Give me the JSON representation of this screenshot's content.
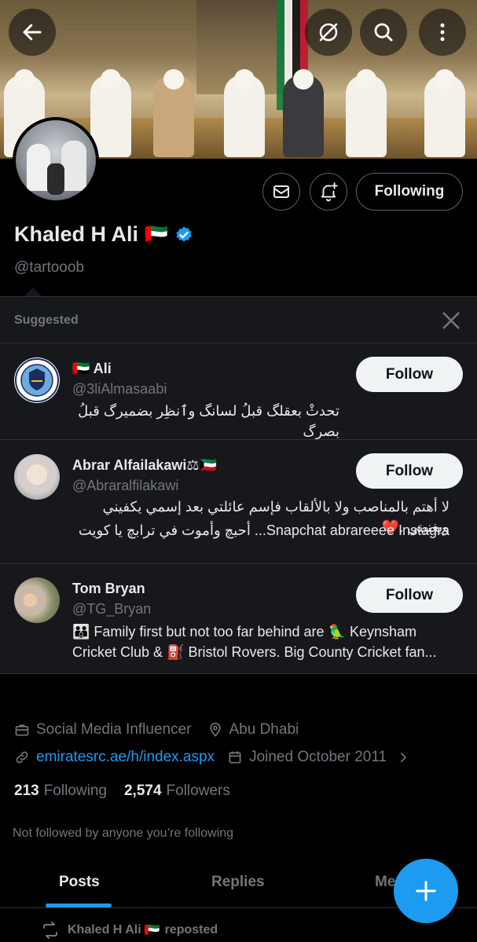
{
  "profile": {
    "name": "Khaled H Ali",
    "flag": "🇦🇪",
    "handle": "@tartooob",
    "following_label": "Following"
  },
  "suggested": {
    "title": "Suggested",
    "items": [
      {
        "name": "🇦🇪 Ali",
        "handle": "@3liAlmasaabi",
        "bio_lines": [
          "تحدثْ بعقلگ قبلُ لسانگ وٱنظِر بضميرگ قبلُ بصرگ"
        ],
        "button": "Follow"
      },
      {
        "name": "Abrar Alfailakawi⚖🇰🇼",
        "handle": "@Abraralfilakawi",
        "bio_lines": [
          "لا أهتم بالمناصب ولا بالألقاب فإسم عائلتي بعد إسمي يكفيني ويغنيني .❤️",
          "Snapchat abrareeee Instagra... أحبچ وأموت في ترابچ يا كويت"
        ],
        "button": "Follow"
      },
      {
        "name": "Tom Bryan",
        "handle": "@TG_Bryan",
        "bio_lines": [
          "👪 Family first but not too far behind are 🦜 Keynsham",
          "Cricket Club & ⛽ Bristol Rovers. Big County Cricket fan..."
        ],
        "button": "Follow"
      }
    ]
  },
  "meta": {
    "category": "Social Media Influencer",
    "location": "Abu Dhabi",
    "website": "emiratesrc.ae/h/index.aspx",
    "joined": "Joined October 2011"
  },
  "counts": {
    "following_num": "213",
    "following_label": "Following",
    "followers_num": "2,574",
    "followers_label": "Followers"
  },
  "not_followed": "Not followed by anyone you’re following",
  "tabs": [
    "Posts",
    "Replies",
    "Me"
  ],
  "repost": {
    "name": "Khaled H Ali",
    "flag": "🇦🇪",
    "label": "reposted"
  },
  "colors": {
    "accent": "#1d9bf0",
    "verified": "#1d9bf0",
    "background": "#000000",
    "panel": "#16181c"
  }
}
